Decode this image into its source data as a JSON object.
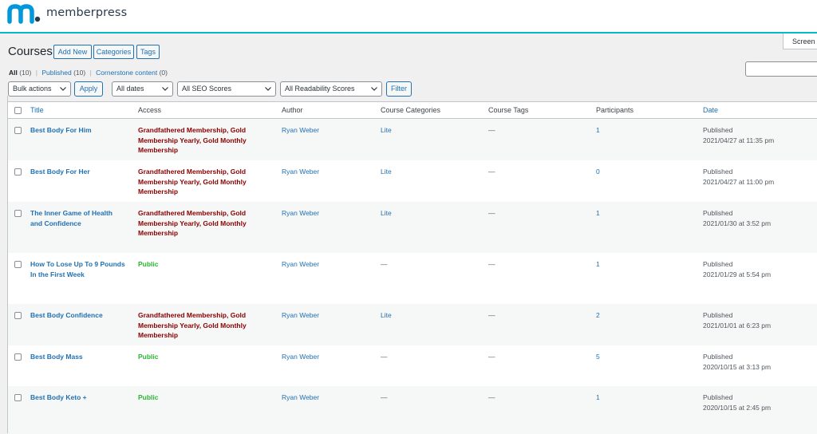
{
  "brand": {
    "name": "memberpress",
    "colors": {
      "accent": "#06b9c9",
      "mark": "#0098da",
      "link": "#2271b1",
      "access_restricted": "#8a0000",
      "access_public": "#2bb631"
    }
  },
  "screen_options": {
    "label": "Screen C"
  },
  "page": {
    "title": "Courses",
    "buttons": {
      "add_new": "Add New",
      "categories": "Categories",
      "tags": "Tags"
    }
  },
  "views": {
    "all": {
      "label": "All",
      "count": "(10)"
    },
    "published": {
      "label": "Published",
      "count": "(10)"
    },
    "cornerstone": {
      "label": "Cornerstone content",
      "count": "(0)"
    },
    "separator": "|"
  },
  "filters": {
    "bulk_actions": "Bulk actions",
    "apply": "Apply",
    "dates": "All dates",
    "seo": "All SEO Scores",
    "readability": "All Readability Scores",
    "filter": "Filter"
  },
  "columns": {
    "title": "Title",
    "access": "Access",
    "author": "Author",
    "categories": "Course Categories",
    "tags": "Course Tags",
    "participants": "Participants",
    "date": "Date"
  },
  "rows": [
    {
      "title": [
        "Best Body For Him"
      ],
      "access": [
        "Grandfathered Membership, Gold",
        "Membership Yearly, Gold Monthly",
        "Membership"
      ],
      "access_type": "restricted",
      "author": "Ryan Weber",
      "categories": "Lite",
      "tags": "—",
      "participants": "1",
      "status": "Published",
      "date": "2021/04/27 at 11:35 pm"
    },
    {
      "title": [
        "Best Body For Her"
      ],
      "access": [
        "Grandfathered Membership, Gold",
        "Membership Yearly, Gold Monthly",
        "Membership"
      ],
      "access_type": "restricted",
      "author": "Ryan Weber",
      "categories": "Lite",
      "tags": "—",
      "participants": "0",
      "status": "Published",
      "date": "2021/04/27 at 11:00 pm"
    },
    {
      "title": [
        "The Inner Game of Health",
        "and Confidence"
      ],
      "access": [
        "Grandfathered Membership, Gold",
        "Membership Yearly, Gold Monthly",
        "Membership"
      ],
      "access_type": "restricted",
      "author": "Ryan Weber",
      "categories": "Lite",
      "tags": "—",
      "participants": "1",
      "status": "Published",
      "date": "2021/01/30 at 3:52 pm"
    },
    {
      "title": [
        "How To Lose Up To 9 Pounds",
        "In the First Week"
      ],
      "access": [
        "Public"
      ],
      "access_type": "public",
      "author": "Ryan Weber",
      "categories": "—",
      "tags": "—",
      "participants": "1",
      "status": "Published",
      "date": "2021/01/29 at 5:54 pm"
    },
    {
      "title": [
        "Best Body Confidence"
      ],
      "access": [
        "Grandfathered Membership, Gold",
        "Membership Yearly, Gold Monthly",
        "Membership"
      ],
      "access_type": "restricted",
      "author": "Ryan Weber",
      "categories": "Lite",
      "tags": "—",
      "participants": "2",
      "status": "Published",
      "date": "2021/01/01 at 6:23 pm"
    },
    {
      "title": [
        "Best Body Mass"
      ],
      "access": [
        "Public"
      ],
      "access_type": "public",
      "author": "Ryan Weber",
      "categories": "—",
      "tags": "—",
      "participants": "5",
      "status": "Published",
      "date": "2020/10/15 at 3:13 pm"
    },
    {
      "title": [
        "Best Body Keto +"
      ],
      "access": [
        "Public"
      ],
      "access_type": "public",
      "author": "Ryan Weber",
      "categories": "—",
      "tags": "—",
      "participants": "1",
      "status": "Published",
      "date": "2020/10/15 at 2:45 pm"
    }
  ]
}
